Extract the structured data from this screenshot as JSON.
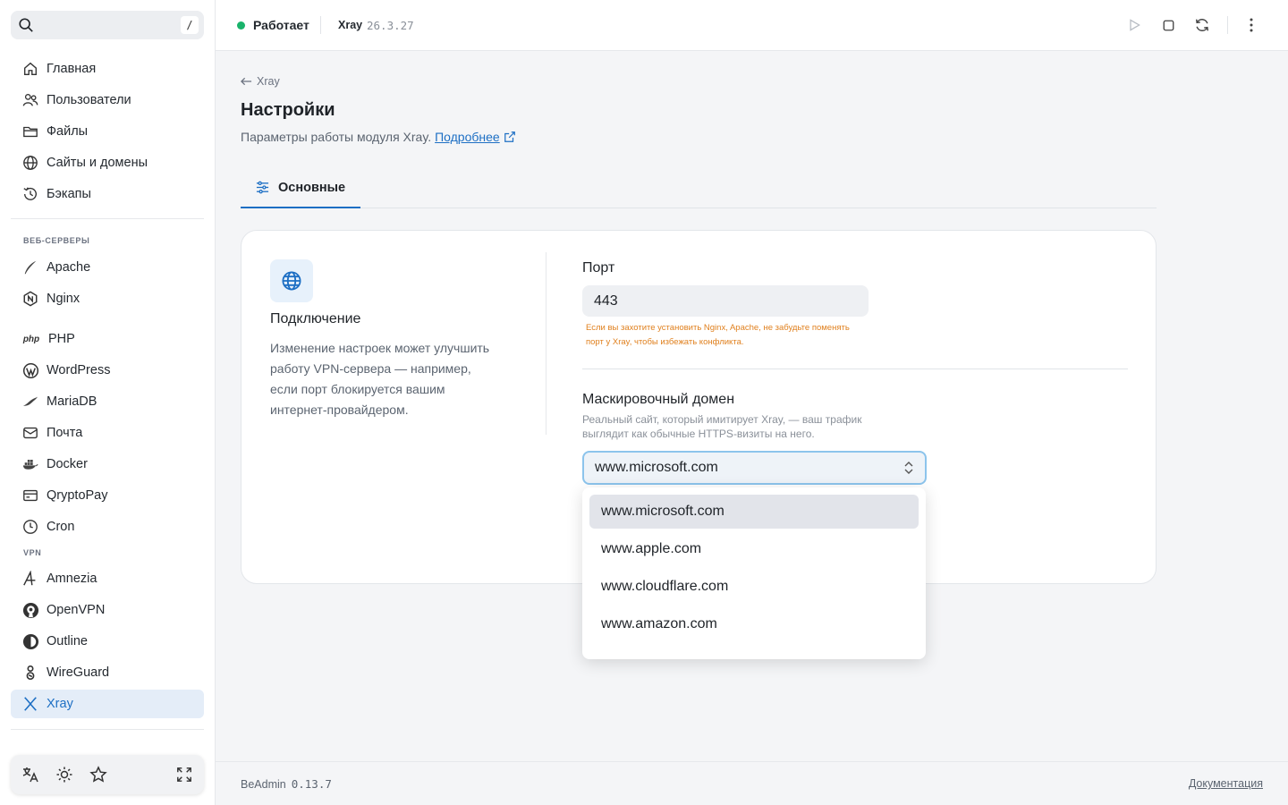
{
  "search": {
    "shortcut": "/"
  },
  "sidebar": {
    "main_items": [
      {
        "label": "Главная",
        "icon": "home-icon"
      },
      {
        "label": "Пользователи",
        "icon": "users-icon"
      },
      {
        "label": "Файлы",
        "icon": "folder-icon"
      },
      {
        "label": "Сайты и домены",
        "icon": "globe-icon"
      },
      {
        "label": "Бэкапы",
        "icon": "history-icon"
      }
    ],
    "web_section": "ВЕБ-СЕРВЕРЫ",
    "web_items": [
      {
        "label": "Apache",
        "icon": "apache-feather-icon"
      },
      {
        "label": "Nginx",
        "icon": "nginx-icon"
      },
      {
        "label": "PHP",
        "icon": "php-icon"
      },
      {
        "label": "WordPress",
        "icon": "wordpress-icon"
      },
      {
        "label": "MariaDB",
        "icon": "mariadb-icon"
      },
      {
        "label": "Почта",
        "icon": "mail-icon"
      },
      {
        "label": "Docker",
        "icon": "docker-icon"
      },
      {
        "label": "QryptoPay",
        "icon": "card-icon"
      },
      {
        "label": "Cron",
        "icon": "clock-icon"
      }
    ],
    "vpn_section": "VPN",
    "vpn_items": [
      {
        "label": "Amnezia",
        "icon": "amnezia-icon"
      },
      {
        "label": "OpenVPN",
        "icon": "openvpn-icon"
      },
      {
        "label": "Outline",
        "icon": "outline-icon"
      },
      {
        "label": "WireGuard",
        "icon": "wireguard-icon"
      },
      {
        "label": "Xray",
        "icon": "xray-icon",
        "active": true
      }
    ]
  },
  "topbar": {
    "status": "Работает",
    "status_color": "#19b36b",
    "module": "Xray",
    "version": "26.3.27"
  },
  "page": {
    "back_label": "Xray",
    "title": "Настройки",
    "description": "Параметры работы модуля Xray.",
    "more_link": "Подробнее",
    "tab_label": "Основные"
  },
  "card": {
    "title": "Подключение",
    "description": "Изменение настроек может улучшить работу VPN-сервера — например, если порт блокируется вашим интернет-провайдером.",
    "port_label": "Порт",
    "port_value": "443",
    "port_warning": "Если вы захотите установить Nginx, Apache, не забудьте поменять порт у Xray, чтобы избежать конфликта.",
    "domain_label": "Маскировочный домен",
    "domain_help": "Реальный сайт, который имитирует Xray, — ваш трафик выглядит как обычные HTTPS-визиты на него.",
    "domain_value": "www.microsoft.com"
  },
  "dropdown": {
    "options": [
      "www.microsoft.com",
      "www.apple.com",
      "www.cloudflare.com",
      "www.amazon.com"
    ]
  },
  "footer": {
    "app_name": "BeAdmin",
    "app_version": "0.13.7",
    "docs_link": "Документация"
  },
  "colors": {
    "accent": "#1d6fc4",
    "warning": "#e0801e",
    "active_bg": "#e4edf8"
  }
}
